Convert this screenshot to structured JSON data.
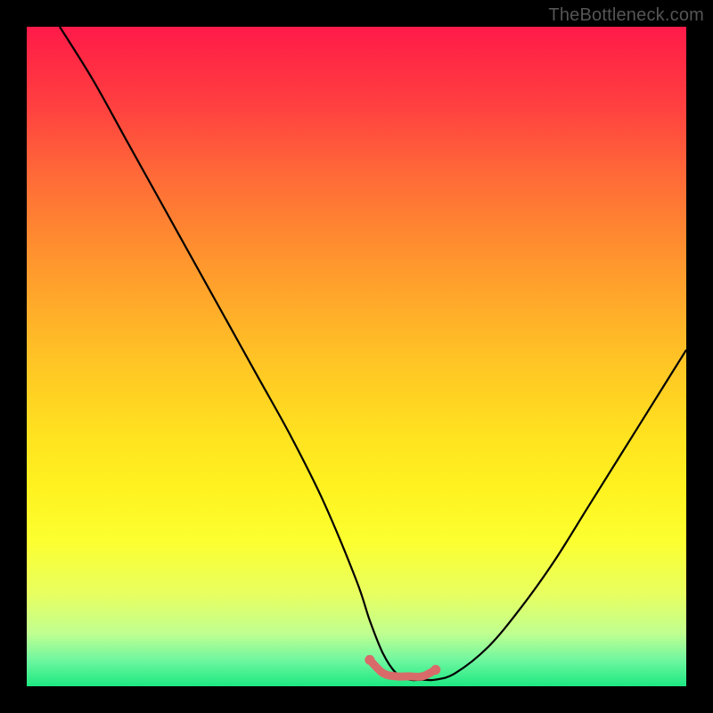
{
  "watermark": "TheBottleneck.com",
  "chart_data": {
    "type": "line",
    "title": "",
    "xlabel": "",
    "ylabel": "",
    "xlim": [
      0,
      100
    ],
    "ylim": [
      0,
      100
    ],
    "series": [
      {
        "name": "bottleneck-curve",
        "x": [
          5,
          10,
          15,
          20,
          25,
          30,
          35,
          40,
          45,
          50,
          52,
          54,
          56,
          58,
          60,
          62,
          65,
          70,
          75,
          80,
          85,
          90,
          95,
          100
        ],
        "y": [
          100,
          92,
          83,
          74,
          65,
          56,
          47,
          38,
          28,
          16,
          10,
          5,
          2,
          1,
          1,
          1,
          2,
          6,
          12,
          19,
          27,
          35,
          43,
          51
        ]
      }
    ],
    "highlight_segment": {
      "name": "flat-bottom",
      "x": [
        52,
        54,
        56,
        58,
        60,
        62
      ],
      "y": [
        4,
        2,
        1.5,
        1.5,
        1.5,
        2.5
      ],
      "color": "#d96a6a"
    },
    "colors": {
      "curve": "#000000",
      "highlight": "#d96a6a",
      "gradient_top": "#ff1a4a",
      "gradient_bottom": "#1de881"
    }
  }
}
